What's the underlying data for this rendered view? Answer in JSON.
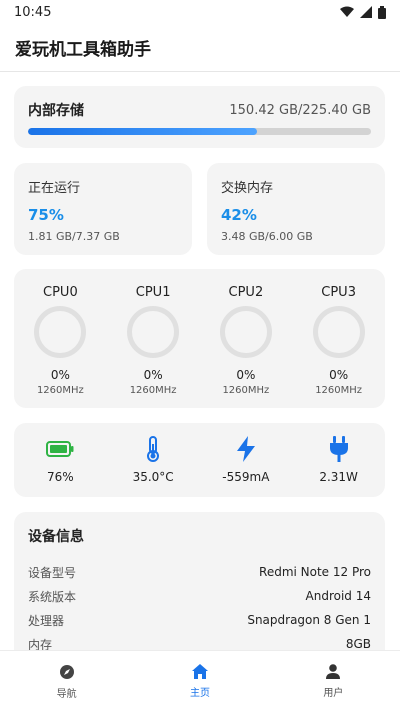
{
  "status_bar": {
    "time": "10:45"
  },
  "app": {
    "title": "爱玩机工具箱助手"
  },
  "storage": {
    "title": "内部存储",
    "value": "150.42 GB/225.40 GB",
    "fraction": 0.667
  },
  "memory": [
    {
      "title": "正在运行",
      "percent": "75%",
      "detail": "1.81 GB/7.37 GB"
    },
    {
      "title": "交换内存",
      "percent": "42%",
      "detail": "3.48 GB/6.00 GB"
    }
  ],
  "cpu": [
    {
      "name": "CPU0",
      "load": "0%",
      "freq": "1260MHz"
    },
    {
      "name": "CPU1",
      "load": "0%",
      "freq": "1260MHz"
    },
    {
      "name": "CPU2",
      "load": "0%",
      "freq": "1260MHz"
    },
    {
      "name": "CPU3",
      "load": "0%",
      "freq": "1260MHz"
    }
  ],
  "stats": [
    {
      "icon": "battery-icon",
      "value": "76%"
    },
    {
      "icon": "thermometer-icon",
      "value": "35.0°C"
    },
    {
      "icon": "lightning-icon",
      "value": "-559mA"
    },
    {
      "icon": "plug-icon",
      "value": "2.31W"
    }
  ],
  "device": {
    "title": "设备信息",
    "rows": [
      {
        "label": "设备型号",
        "value": "Redmi Note 12 Pro"
      },
      {
        "label": "系统版本",
        "value": "Android 14"
      },
      {
        "label": "处理器",
        "value": "Snapdragon 8 Gen 1"
      },
      {
        "label": "内存",
        "value": "8GB"
      }
    ]
  },
  "nav": [
    {
      "label": "导航",
      "icon": "compass-icon"
    },
    {
      "label": "主页",
      "icon": "home-icon"
    },
    {
      "label": "用户",
      "icon": "user-icon"
    }
  ],
  "colors": {
    "accent": "#1a73e8",
    "battery": "#2fb344",
    "thermo": "#1a73e8"
  }
}
